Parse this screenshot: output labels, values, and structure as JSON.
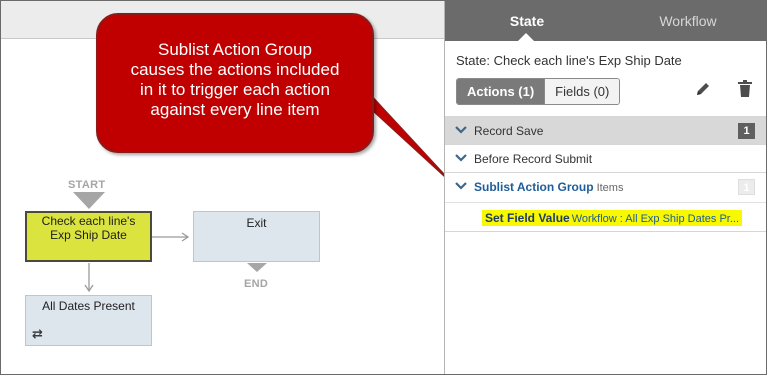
{
  "callout": {
    "line1": "Sublist Action Group",
    "line2": "causes the actions included",
    "line3": "in it to trigger each action",
    "line4": "against every line item"
  },
  "canvas": {
    "start_label": "START",
    "end_label": "END",
    "nodes": {
      "check": {
        "line1": "Check each line's",
        "line2": "Exp Ship Date"
      },
      "exit": {
        "label": "Exit"
      },
      "dates": {
        "label": "All Dates Present",
        "icon": "repeat-icon"
      }
    }
  },
  "panel": {
    "tabs": {
      "state": "State",
      "workflow": "Workflow"
    },
    "state_title": "State: Check each line's Exp Ship Date",
    "subtabs": {
      "actions": "Actions (1)",
      "fields": "Fields (0)"
    },
    "icons": {
      "edit": "pencil-icon",
      "delete": "trash-icon"
    },
    "triggers": [
      {
        "label": "Record Save",
        "count": "1"
      },
      {
        "label": "Before Record Submit"
      },
      {
        "label": "Sublist Action Group",
        "sublabel": "Items",
        "count": "1"
      }
    ],
    "action": {
      "name": "Set Field Value",
      "desc": "Workflow : All Exp Ship Dates Pr..."
    }
  },
  "colors": {
    "callout_bg": "#c00000",
    "selected_node": "#dbe43f",
    "highlight": "#f8f800",
    "tab_bar": "#6b6b6b",
    "link_blue": "#1f5d99"
  }
}
